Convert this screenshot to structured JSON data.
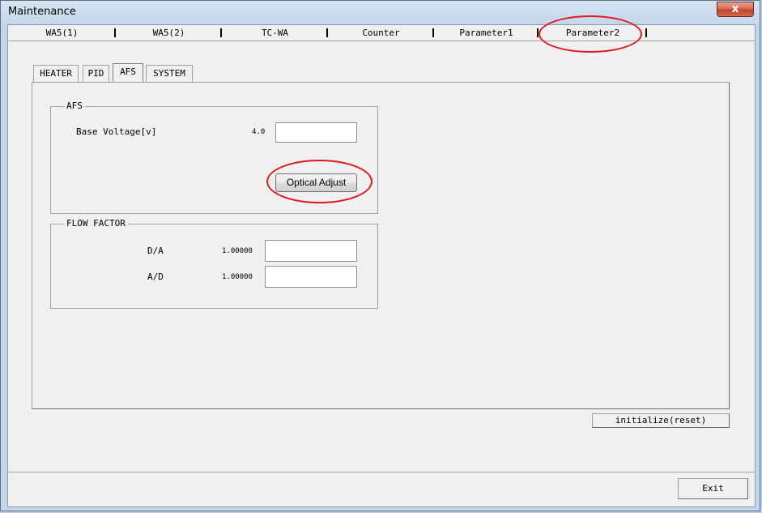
{
  "window": {
    "title": "Maintenance",
    "close_label": "x"
  },
  "top_tabs": [
    {
      "label": "WA5(1)"
    },
    {
      "label": "WA5(2)"
    },
    {
      "label": "TC-WA"
    },
    {
      "label": "Counter"
    },
    {
      "label": "Parameter1"
    },
    {
      "label": "Parameter2",
      "selected": true
    }
  ],
  "sub_tabs": [
    {
      "label": "HEATER"
    },
    {
      "label": "PID"
    },
    {
      "label": "AFS",
      "selected": true
    },
    {
      "label": "SYSTEM"
    }
  ],
  "afs_group": {
    "title": "AFS",
    "base_voltage_label": "Base Voltage[v]",
    "base_voltage_value": "4.0",
    "base_voltage_input": "",
    "optical_adjust_label": "Optical Adjust"
  },
  "flow_factor_group": {
    "title": "FLOW FACTOR",
    "da_label": "D/A",
    "da_value": "1.00000",
    "da_input": "",
    "ad_label": "A/D",
    "ad_value": "1.00000",
    "ad_input": ""
  },
  "footer": {
    "initialize_label": "initialize(reset)",
    "exit_label": "Exit"
  },
  "colors": {
    "highlight_circle": "#e0181e",
    "close_button": "#c2402a"
  }
}
